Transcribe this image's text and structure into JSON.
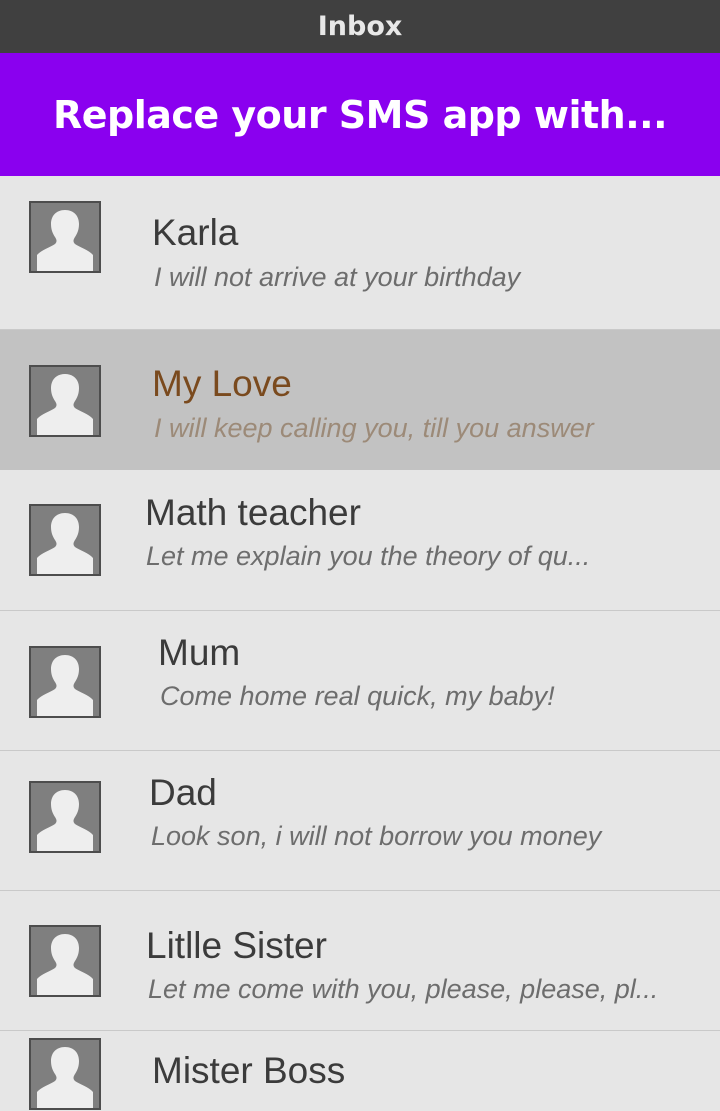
{
  "titlebar": {
    "title": "Inbox"
  },
  "banner": {
    "text": "Replace your SMS app with..."
  },
  "colors": {
    "titlebar_bg": "#404040",
    "banner_bg": "#8a00ef",
    "list_bg": "#e6e6e6",
    "selected_bg": "#c2c2c2",
    "selected_name": "#7a4a1e",
    "selected_message": "#9c8a78"
  },
  "conversations": [
    {
      "name": "Karla",
      "message": "I will not arrive at your birthday",
      "icon": "person-avatar-icon",
      "selected": false
    },
    {
      "name": "My Love",
      "message": "I will keep calling you, till you answer",
      "icon": "person-avatar-icon",
      "selected": true
    },
    {
      "name": "Math teacher",
      "message": "Let me explain you the theory of qu...",
      "icon": "person-avatar-icon",
      "selected": false
    },
    {
      "name": "Mum",
      "message": "Come home real quick, my baby!",
      "icon": "person-avatar-icon",
      "selected": false
    },
    {
      "name": "Dad",
      "message": "Look son, i will not borrow you money",
      "icon": "person-avatar-icon",
      "selected": false
    },
    {
      "name": "Litlle Sister",
      "message": "Let me come with you, please, please, pl...",
      "icon": "person-avatar-icon",
      "selected": false
    },
    {
      "name": "Mister Boss",
      "message": "",
      "icon": "person-avatar-icon",
      "selected": false
    }
  ]
}
